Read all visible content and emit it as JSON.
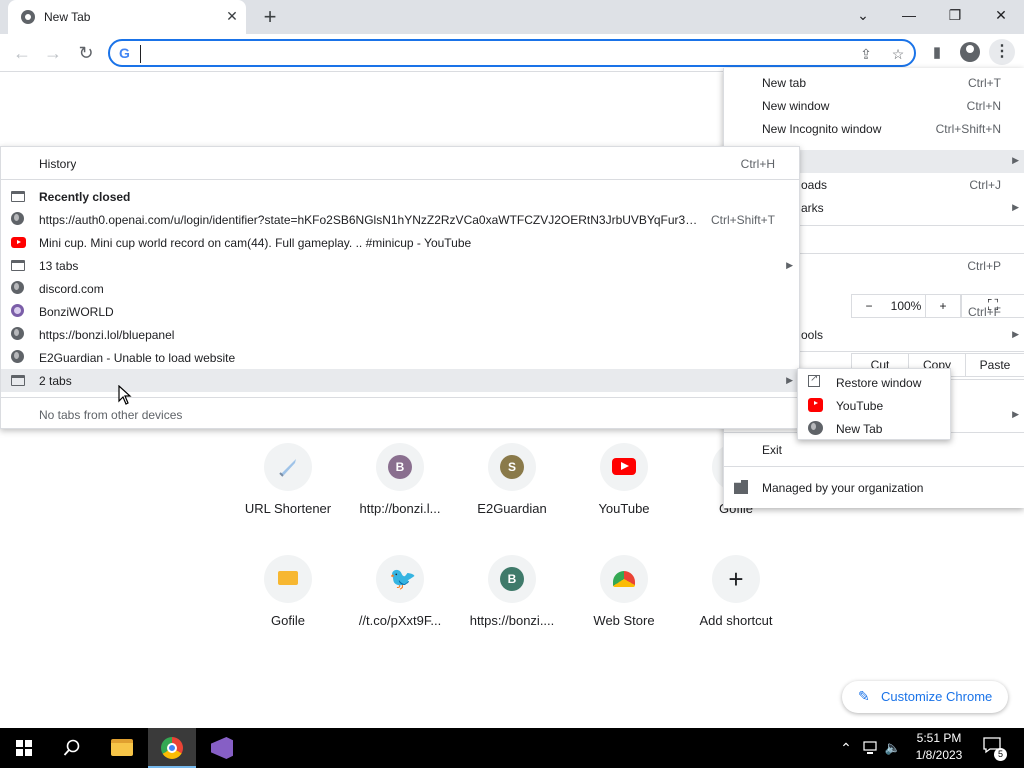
{
  "tab": {
    "title": "New Tab",
    "close_glyph": "✕"
  },
  "window_controls": {
    "tab_search": "⌄",
    "minimize": "—",
    "restore": "❐",
    "close": "✕"
  },
  "toolbar": {
    "back": "←",
    "forward": "→",
    "reload": "↻",
    "omnibox_value": "",
    "share_glyph": "⇪",
    "star_glyph": "☆",
    "sidepanel_glyph": "▮",
    "menu_glyph": "⋮"
  },
  "chrome_menu": {
    "new_tab": {
      "label": "New tab",
      "shortcut": "Ctrl+T"
    },
    "new_window": {
      "label": "New window",
      "shortcut": "Ctrl+N"
    },
    "new_incognito": {
      "label": "New Incognito window",
      "shortcut": "Ctrl+Shift+N"
    },
    "downloads": {
      "label": "oads",
      "shortcut": "Ctrl+J"
    },
    "bookmarks": {
      "label": "arks"
    },
    "zoom": {
      "minus": "−",
      "value": "100%",
      "plus": "+",
      "fullscreen": "⛶"
    },
    "print": {
      "shortcut": "Ctrl+P"
    },
    "find": {
      "shortcut": "Ctrl+F"
    },
    "more_tools": {
      "label": "ools"
    },
    "edit": {
      "cut": "Cut",
      "copy": "Copy",
      "paste": "Paste"
    },
    "exit": "Exit",
    "managed": "Managed by your organization"
  },
  "history_menu": {
    "history": {
      "label": "History",
      "shortcut": "Ctrl+H"
    },
    "recently_closed": "Recently closed",
    "items": [
      {
        "label": "https://auth0.openai.com/u/login/identifier?state=hKFo2SB6NGlsN1hYNzZ2RzVCa0xaWTFCZVJ2OERtN3JrbUVBYqFur3VuaX...",
        "shortcut": "Ctrl+Shift+T",
        "icon": "globe-icon"
      },
      {
        "label": "Mini cup. Mini cup world record on cam(44). Full gameplay. .. #minicup - YouTube",
        "icon": "youtube-icon"
      },
      {
        "label": "13 tabs",
        "icon": "window-icon",
        "submenu": true
      },
      {
        "label": "discord.com",
        "icon": "globe-icon"
      },
      {
        "label": "BonziWORLD",
        "icon": "bonzi-icon"
      },
      {
        "label": "https://bonzi.lol/bluepanel",
        "icon": "globe-icon"
      },
      {
        "label": "E2Guardian - Unable to load website",
        "icon": "globe-icon"
      },
      {
        "label": "2 tabs",
        "icon": "window-icon",
        "submenu": true
      }
    ],
    "other_devices": "No tabs from other devices"
  },
  "tabs_submenu": {
    "restore": "Restore window",
    "items": [
      "YouTube",
      "New Tab"
    ]
  },
  "shortcuts": [
    {
      "label": "URL Shortener",
      "icon": "sword-icon"
    },
    {
      "label": "http://bonzi.l...",
      "letter": "B",
      "color": "#8a6f8f"
    },
    {
      "label": "E2Guardian",
      "letter": "S",
      "color": "#8a7a4a"
    },
    {
      "label": "YouTube",
      "icon": "youtube-icon"
    },
    {
      "label": "Gofile",
      "icon": "folder-icon"
    },
    {
      "label": "Gofile",
      "icon": "folder-icon"
    },
    {
      "label": "//t.co/pXxt9F...",
      "icon": "twitter-icon"
    },
    {
      "label": "https://bonzi....",
      "letter": "B",
      "color": "#3f7a6a"
    },
    {
      "label": "Web Store",
      "icon": "webstore-icon"
    },
    {
      "label": "Add shortcut",
      "icon": "plus-icon"
    }
  ],
  "customize": {
    "label": "Customize Chrome",
    "icon": "pencil-icon"
  },
  "taskbar": {
    "time": "5:51 PM",
    "date": "1/8/2023",
    "notification_count": "5",
    "tray_chevron": "⌃",
    "volume_glyph": "🔈"
  },
  "colors": {
    "accent": "#1a73e8",
    "tabstrip": "#dee1e6",
    "taskbar": "#000000"
  }
}
